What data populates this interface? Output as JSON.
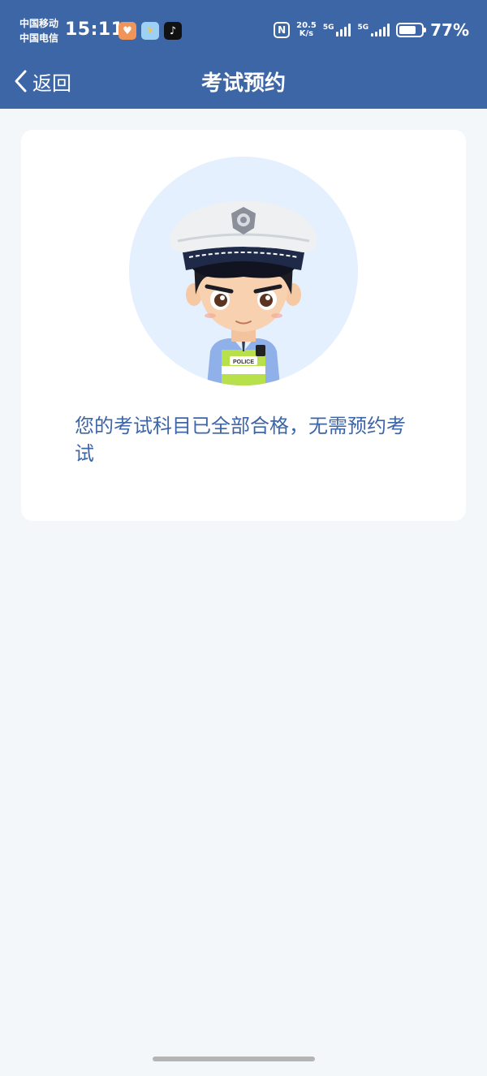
{
  "status_bar": {
    "carrier_1": "中国移动",
    "carrier_2": "中国电信",
    "time": "15:11",
    "net_speed_value": "20.5",
    "net_speed_unit": "K/s",
    "sim1_network": "5G",
    "sim2_network": "5G",
    "battery": "77%",
    "battery_level": 0.77,
    "app_icons": [
      "heart-app-icon",
      "weather-app-icon",
      "tiktok-app-icon"
    ]
  },
  "nav": {
    "back_label": "返回",
    "title": "考试预约"
  },
  "content": {
    "message": "您的考试科目已全部合格，无需预约考试",
    "illustration": "police-officer-avatar",
    "badge_text": "POLICE"
  },
  "colors": {
    "header": "#3d66a7",
    "background": "#f3f7f9",
    "card": "#ffffff",
    "message_text": "#3d66a7",
    "avatar_bg": "#e5f0fe"
  }
}
